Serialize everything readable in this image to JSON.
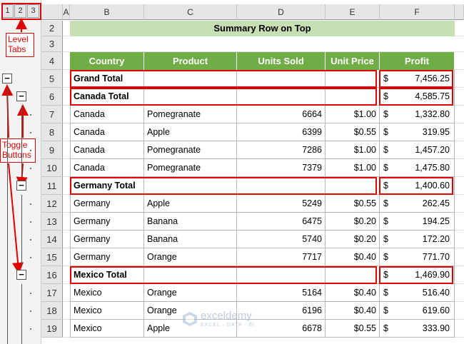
{
  "outline": {
    "levels": [
      "1",
      "2",
      "3"
    ],
    "toggle_symbol": "−"
  },
  "annotations": {
    "level_tabs": "Level\nTabs",
    "toggle_buttons": "Toggle\nButtons"
  },
  "columns": [
    "A",
    "B",
    "C",
    "D",
    "E",
    "F"
  ],
  "rows": [
    "2",
    "3",
    "4",
    "5",
    "6",
    "7",
    "8",
    "9",
    "10",
    "11",
    "12",
    "13",
    "14",
    "15",
    "16",
    "17",
    "18",
    "19"
  ],
  "title": "Summary Row on Top",
  "table": {
    "headers": [
      "Country",
      "Product",
      "Units Sold",
      "Unit Price",
      "Profit"
    ],
    "rows": [
      {
        "country": "Grand Total",
        "product": "",
        "units": "",
        "price": "",
        "cur": "$",
        "profit": "7,456.25",
        "bold": true
      },
      {
        "country": "Canada Total",
        "product": "",
        "units": "",
        "price": "",
        "cur": "$",
        "profit": "4,585.75",
        "bold": true
      },
      {
        "country": "Canada",
        "product": "Pomegranate",
        "units": "6664",
        "price": "$1.00",
        "cur": "$",
        "profit": "1,332.80"
      },
      {
        "country": "Canada",
        "product": "Apple",
        "units": "6399",
        "price": "$0.55",
        "cur": "$",
        "profit": "319.95"
      },
      {
        "country": "Canada",
        "product": "Pomegranate",
        "units": "7286",
        "price": "$1.00",
        "cur": "$",
        "profit": "1,457.20"
      },
      {
        "country": "Canada",
        "product": "Pomegranate",
        "units": "7379",
        "price": "$1.00",
        "cur": "$",
        "profit": "1,475.80"
      },
      {
        "country": "Germany Total",
        "product": "",
        "units": "",
        "price": "",
        "cur": "$",
        "profit": "1,400.60",
        "bold": true
      },
      {
        "country": "Germany",
        "product": "Apple",
        "units": "5249",
        "price": "$0.55",
        "cur": "$",
        "profit": "262.45"
      },
      {
        "country": "Germany",
        "product": "Banana",
        "units": "6475",
        "price": "$0.20",
        "cur": "$",
        "profit": "194.25"
      },
      {
        "country": "Germany",
        "product": "Banana",
        "units": "5740",
        "price": "$0.20",
        "cur": "$",
        "profit": "172.20"
      },
      {
        "country": "Germany",
        "product": "Orange",
        "units": "7717",
        "price": "$0.40",
        "cur": "$",
        "profit": "771.70"
      },
      {
        "country": "Mexico Total",
        "product": "",
        "units": "",
        "price": "",
        "cur": "$",
        "profit": "1,469.90",
        "bold": true
      },
      {
        "country": "Mexico",
        "product": "Orange",
        "units": "5164",
        "price": "$0.40",
        "cur": "$",
        "profit": "516.40"
      },
      {
        "country": "Mexico",
        "product": "Orange",
        "units": "6196",
        "price": "$0.40",
        "cur": "$",
        "profit": "619.60"
      },
      {
        "country": "Mexico",
        "product": "Apple",
        "units": "6678",
        "price": "$0.55",
        "cur": "$",
        "profit": "333.90"
      }
    ]
  },
  "watermark": {
    "name": "exceldemy",
    "tagline": "EXCEL · DATA · BI"
  },
  "colors": {
    "header_green": "#70ad47",
    "title_fill": "#c6e0b4",
    "annotation_red": "#e00000"
  }
}
